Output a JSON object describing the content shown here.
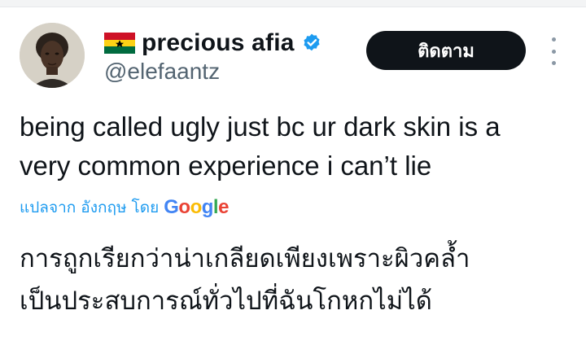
{
  "author": {
    "flag_icon": "ghana-flag-icon",
    "display_name": "precious afia",
    "verified_icon": "verified-badge-icon",
    "handle": "@elefaantz"
  },
  "follow_button": {
    "label": "ติดตาม"
  },
  "more_icon": "more-vertical-icon",
  "tweet": {
    "lines": [
      "being called ugly just bc ur dark skin is a",
      "very common experience i can’t lie"
    ]
  },
  "translation": {
    "link_text": "แปลจาก อังกฤษ โดย",
    "provider_letters": [
      "G",
      "o",
      "o",
      "g",
      "l",
      "e"
    ],
    "provider_colors": [
      "#4285F4",
      "#EA4335",
      "#FBBC05",
      "#4285F4",
      "#34A853",
      "#EA4335"
    ],
    "lines": [
      "การถูกเรียกว่าน่าเกลียดเพียงเพราะผิวคล้ำ",
      "เป็นประสบการณ์ทั่วไปที่ฉันโกหกไม่ได้"
    ]
  },
  "colors": {
    "text": "#0f1419",
    "secondary": "#536471",
    "link": "#1d9bf0",
    "button_bg": "#0f1419",
    "verified": "#1d9bf0"
  }
}
